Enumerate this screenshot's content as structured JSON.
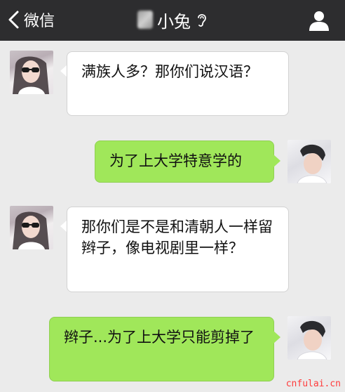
{
  "header": {
    "back_label": "微信",
    "title": "小兔"
  },
  "messages": [
    {
      "side": "left",
      "text": "满族人多？那你们说汉语？"
    },
    {
      "side": "right",
      "text": "为了上大学特意学的"
    },
    {
      "side": "left",
      "text": "那你们是不是和清朝人一样留辫子，像电视剧里一样？"
    },
    {
      "side": "right",
      "text": "辫子...为了上大学只能剪掉了"
    }
  ],
  "watermark": "cnfulai.cn",
  "colors": {
    "header_bg": "#2d2d2f",
    "chat_bg": "#ebebeb",
    "received_bubble": "#ffffff",
    "sent_bubble": "#a0e75a"
  },
  "icons": {
    "back": "chevron-left-icon",
    "ear": "ear-icon",
    "profile": "person-icon"
  }
}
